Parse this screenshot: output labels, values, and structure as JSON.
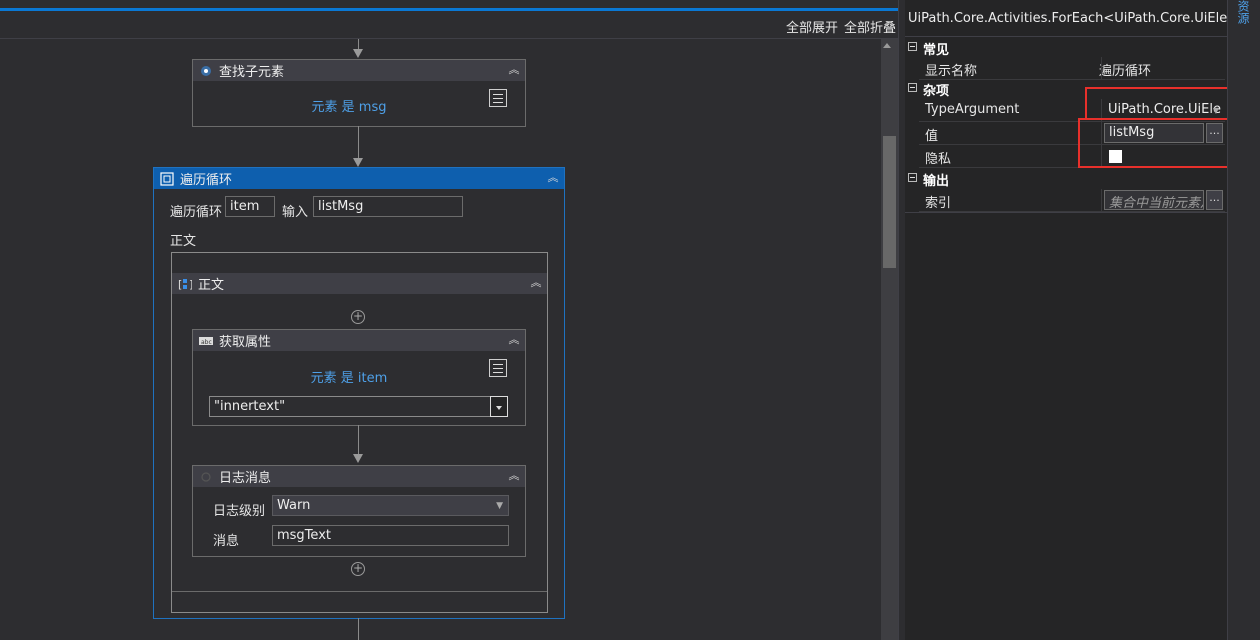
{
  "toolbar": {
    "expand_all": "全部展开",
    "collapse_all": "全部折叠"
  },
  "find_children": {
    "title": "查找子元素",
    "hint": "元素 是 msg"
  },
  "foreach": {
    "title": "遍历循环",
    "loop_label": "遍历循环",
    "item_value": "item",
    "input_label": "输入",
    "input_value": "listMsg",
    "body_label": "正文"
  },
  "sequence": {
    "title": "正文"
  },
  "get_attr": {
    "title": "获取属性",
    "hint": "元素 是 item",
    "attr_value": "\"innertext\""
  },
  "log_msg": {
    "title": "日志消息",
    "level_label": "日志级别",
    "level_value": "Warn",
    "msg_label": "消息",
    "msg_value": "msgText"
  },
  "properties": {
    "type_name": "UiPath.Core.Activities.ForEach<UiPath.Core.UiEleme...",
    "categories": {
      "common": "常见",
      "misc": "杂项",
      "output": "输出"
    },
    "display_name_label": "显示名称",
    "display_name_value": "遍历循环",
    "type_argument_label": "TypeArgument",
    "type_argument_value": "UiPath.Core.UiEle",
    "value_label": "值",
    "value_value": "listMsg",
    "private_label": "隐私",
    "index_label": "索引",
    "index_placeholder": "集合中当前元素从"
  },
  "side_tab": "资源",
  "colors": {
    "accent": "#0a78d4",
    "hint": "#4ea0e8",
    "highlight": "#e8302b"
  }
}
